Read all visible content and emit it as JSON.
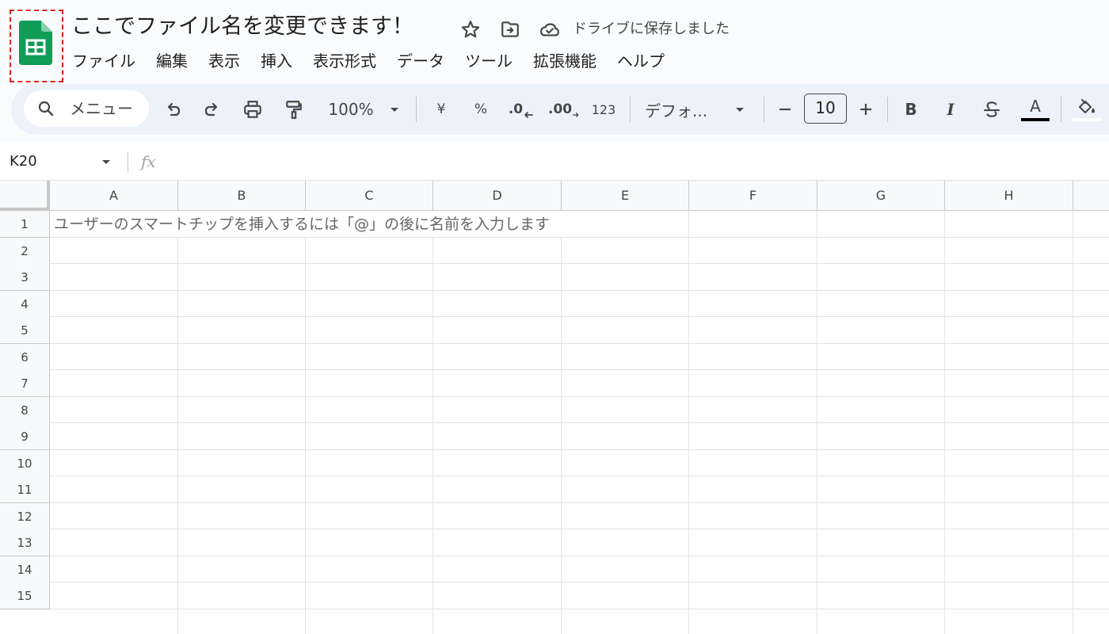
{
  "header": {
    "title": "ここでファイル名を変更できます！",
    "save_status": "ドライブに保存しました",
    "icons": [
      "sheets-logo-icon",
      "star-icon",
      "move-to-folder-icon",
      "cloud-saved-icon"
    ]
  },
  "menu": [
    "ファイル",
    "編集",
    "表示",
    "挿入",
    "表示形式",
    "データ",
    "ツール",
    "拡張機能",
    "ヘルプ"
  ],
  "toolbar": {
    "search_label": "メニュー",
    "zoom": "100%",
    "currency": "¥",
    "percent": "%",
    "decrease_decimal": ".0",
    "increase_decimal": ".00",
    "number_format": "123",
    "font": "デフォ...",
    "font_size": "10",
    "bold": "B",
    "italic": "I",
    "text_color": "A"
  },
  "formula_bar": {
    "name_box": "K20",
    "fx": "fx"
  },
  "grid": {
    "columns": [
      "A",
      "B",
      "C",
      "D",
      "E",
      "F",
      "G",
      "H"
    ],
    "rows": [
      "1",
      "2",
      "3",
      "4",
      "5",
      "6",
      "7",
      "8",
      "9",
      "10",
      "11",
      "12",
      "13",
      "14",
      "15"
    ],
    "cell_a1": "ユーザーのスマートチップを挿入するには「@」の後に名前を入力します"
  },
  "colors": {
    "brand": "#0f9d58",
    "accent_dashed": "#e02424",
    "toolbar_bg": "#edf2fa"
  }
}
